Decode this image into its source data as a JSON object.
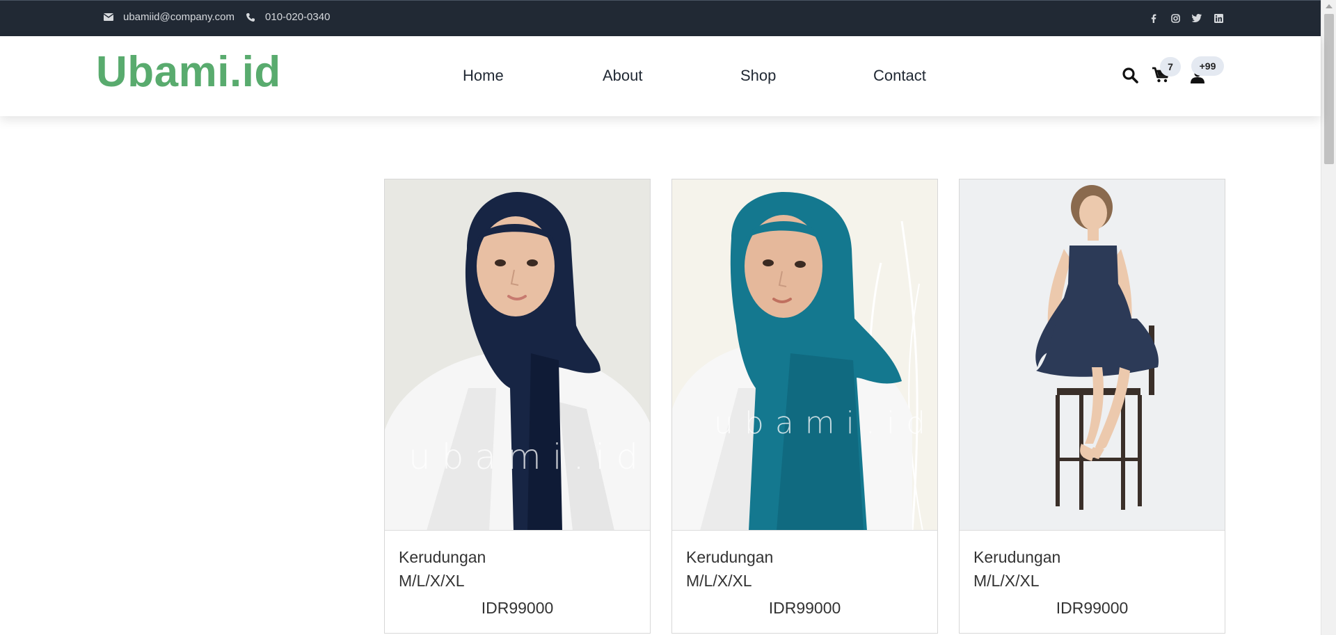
{
  "topbar": {
    "email": "ubamiid@company.com",
    "phone": "010-020-0340",
    "social": [
      "facebook-icon",
      "instagram-icon",
      "twitter-icon",
      "linkedin-icon"
    ]
  },
  "brand": {
    "logo": "Ubami.id",
    "color": "#59ab6e"
  },
  "nav": {
    "items": [
      {
        "label": "Home"
      },
      {
        "label": "About"
      },
      {
        "label": "Shop"
      },
      {
        "label": "Contact"
      }
    ],
    "cart_count": "7",
    "user_count": "+99"
  },
  "products": [
    {
      "name": "Kerudungan",
      "sizes": "M/L/X/XL",
      "price": "IDR99000",
      "watermark": "ubami.id",
      "hijab_color": "#172544"
    },
    {
      "name": "Kerudungan",
      "sizes": "M/L/X/XL",
      "price": "IDR99000",
      "watermark": "ubami.id",
      "hijab_color": "#14788f"
    },
    {
      "name": "Kerudungan",
      "sizes": "M/L/X/XL",
      "price": "IDR99000",
      "dress_color": "#2c3a57"
    }
  ],
  "colors": {
    "topbar": "#212934",
    "accent": "#59ab6e"
  }
}
